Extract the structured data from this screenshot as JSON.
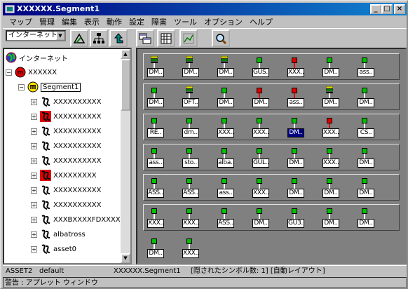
{
  "window": {
    "title": "XXXXXX.Segment1",
    "min_label": "_",
    "max_label": "□",
    "close_label": "×"
  },
  "menu": [
    "マップ",
    "管理",
    "編集",
    "表示",
    "動作",
    "設定",
    "障害",
    "ツール",
    "オプション",
    "ヘルプ"
  ],
  "toolbar": {
    "combo_value": "インターネット",
    "tools": [
      "map-up-icon",
      "network-tree-icon",
      "up-arrow-icon",
      "submap-icon",
      "calculator-icon",
      "graph-icon",
      "zoom-icon"
    ]
  },
  "tree": [
    {
      "label": "インターネット",
      "icon": "globe-icon",
      "level": 0,
      "expander": ""
    },
    {
      "label": "XXXXXX",
      "icon": "segment-red-icon",
      "level": 1,
      "expander": "−"
    },
    {
      "label": "Segment1",
      "icon": "segment-yellow-icon",
      "level": 2,
      "expander": "−",
      "boxed": true
    },
    {
      "label": "XXXXXXXXXX",
      "icon": "node-icon",
      "level": 3,
      "expander": "+"
    },
    {
      "label": "XXXXXXXXXX",
      "icon": "node-red-icon",
      "level": 3,
      "expander": "+"
    },
    {
      "label": "XXXXXXXXXX",
      "icon": "node-icon",
      "level": 3,
      "expander": "+"
    },
    {
      "label": "XXXXXXXXXX",
      "icon": "node-icon",
      "level": 3,
      "expander": "+"
    },
    {
      "label": "XXXXXXXXXX",
      "icon": "node-icon",
      "level": 3,
      "expander": "+"
    },
    {
      "label": "XXXXXXXXX",
      "icon": "node-red-icon",
      "level": 3,
      "expander": "+"
    },
    {
      "label": "XXXXXXXXXX",
      "icon": "node-icon",
      "level": 3,
      "expander": "+"
    },
    {
      "label": "XXXXXXXXXX",
      "icon": "node-icon",
      "level": 3,
      "expander": "+"
    },
    {
      "label": "XXXBXXXXFDXXXXX",
      "icon": "node-icon",
      "level": 3,
      "expander": "+"
    },
    {
      "label": "albatross",
      "icon": "node-icon",
      "level": 3,
      "expander": "+"
    },
    {
      "label": "asset0",
      "icon": "node-icon",
      "level": 3,
      "expander": "+"
    }
  ],
  "map_rows": [
    [
      {
        "label": "DM..",
        "status": "server"
      },
      {
        "label": "DM..",
        "status": "server"
      },
      {
        "label": "DM..",
        "status": "server"
      },
      {
        "label": "GUS..",
        "status": "green"
      },
      {
        "label": "XXX..",
        "status": "red"
      },
      {
        "label": "DM..",
        "status": "green"
      },
      {
        "label": "ass..",
        "status": "green"
      }
    ],
    [
      {
        "label": "DM..",
        "status": "green"
      },
      {
        "label": "OFT..",
        "status": "server"
      },
      {
        "label": "DM..",
        "status": "green"
      },
      {
        "label": "DM..",
        "status": "red"
      },
      {
        "label": "ass..",
        "status": "red"
      },
      {
        "label": "DM..",
        "status": "server"
      },
      {
        "label": "DM..",
        "status": "green"
      }
    ],
    [
      {
        "label": "RE..",
        "status": "green"
      },
      {
        "label": "dm..",
        "status": "green"
      },
      {
        "label": "XXX..",
        "status": "green"
      },
      {
        "label": "XXX..",
        "status": "green"
      },
      {
        "label": "DM..",
        "status": "green",
        "selected": true
      },
      {
        "label": "XXX..",
        "status": "red"
      },
      {
        "label": "CS..",
        "status": "green"
      }
    ],
    [
      {
        "label": "ass..",
        "status": "green"
      },
      {
        "label": "sto..",
        "status": "green"
      },
      {
        "label": "alba..",
        "status": "green"
      },
      {
        "label": "GUL..",
        "status": "green"
      },
      {
        "label": "DM..",
        "status": "green"
      },
      {
        "label": "XXX..",
        "status": "green"
      },
      {
        "label": "DM..",
        "status": "green"
      }
    ],
    [
      {
        "label": "ASS..",
        "status": "green"
      },
      {
        "label": "ASS..",
        "status": "green"
      },
      {
        "label": "ass..",
        "status": "green"
      },
      {
        "label": "XXX..",
        "status": "green"
      },
      {
        "label": "DM..",
        "status": "green"
      },
      {
        "label": "DM..",
        "status": "green"
      },
      {
        "label": "DM..",
        "status": "green"
      }
    ],
    [
      {
        "label": "XXX..",
        "status": "green"
      },
      {
        "label": "XXX..",
        "status": "green"
      },
      {
        "label": "ASS..",
        "status": "green"
      },
      {
        "label": "DM..",
        "status": "green"
      },
      {
        "label": "GU3..",
        "status": "green"
      },
      {
        "label": "DM..",
        "status": "green"
      },
      {
        "label": "DM..",
        "status": "green"
      }
    ],
    [
      {
        "label": "DM..",
        "status": "green"
      },
      {
        "label": "XXX..",
        "status": "green"
      }
    ]
  ],
  "status": {
    "item": "ASSET2",
    "type": "default",
    "path": "XXXXXX.Segment1",
    "info": "[隠されたシンボル数: 1] [自動レイアウト]",
    "warning": "警告 : アプレット ウィンドウ"
  },
  "colors": {
    "title_start": "#000080",
    "title_end": "#1084d0",
    "status_green": "#00c000",
    "status_red": "#e00000",
    "selected": "#000080"
  }
}
